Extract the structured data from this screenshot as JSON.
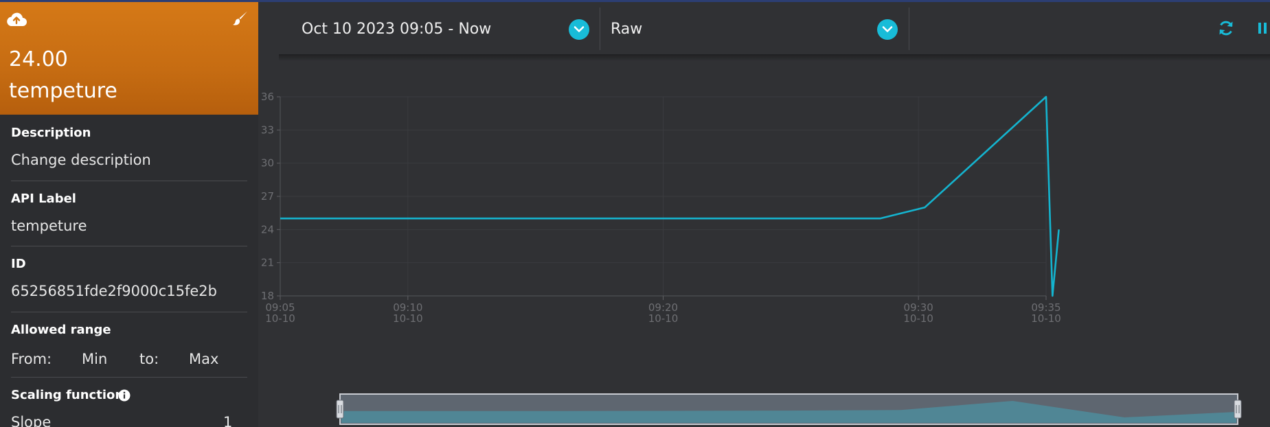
{
  "sensor": {
    "value": "24.00",
    "name": "tempeture",
    "upload_icon": "cloud-upload-icon",
    "edit_icon": "paintbrush-icon"
  },
  "details": {
    "description_label": "Description",
    "description_value": "Change description",
    "api_label_label": "API Label",
    "api_label_value": "tempeture",
    "id_label": "ID",
    "id_value": "65256851fde2f9000c15fe2b",
    "allowed_range_label": "Allowed range",
    "from_label": "From:",
    "from_value": "Min",
    "to_label": "to:",
    "to_value": "Max",
    "scaling_label": "Scaling function",
    "slope_label": "Slope",
    "slope_value": "1"
  },
  "toolbar": {
    "date_range": "Oct 10 2023 09:05 - Now",
    "resolution": "Raw",
    "refresh_icon": "refresh-icon",
    "pause_icon": "pause-icon"
  },
  "colors": {
    "accent": "#18bcd8",
    "card": "#cf7315",
    "line": "#14b4cf"
  },
  "chart_data": {
    "type": "line",
    "x_axis": "time",
    "xlim": [
      "2023-10-10 09:05",
      "2023-10-10 09:35"
    ],
    "ylim": [
      18,
      36
    ],
    "y_ticks": [
      18,
      21,
      24,
      27,
      30,
      33,
      36
    ],
    "x_ticks": [
      {
        "time": "2023-10-10 09:05",
        "line1": "09:05",
        "line2": "10-10"
      },
      {
        "time": "2023-10-10 09:10",
        "line1": "09:10",
        "line2": "10-10"
      },
      {
        "time": "2023-10-10 09:20",
        "line1": "09:20",
        "line2": "10-10"
      },
      {
        "time": "2023-10-10 09:30",
        "line1": "09:30",
        "line2": "10-10"
      },
      {
        "time": "2023-10-10 09:35",
        "line1": "09:35",
        "line2": "10-10"
      }
    ],
    "series": [
      {
        "x": [
          "2023-10-10 09:05:00",
          "2023-10-10 09:28:30",
          "2023-10-10 09:30:15",
          "2023-10-10 09:35:00",
          "2023-10-10 09:35:15",
          "2023-10-10 09:35:30"
        ],
        "y": [
          25,
          25,
          26,
          36,
          18,
          24
        ]
      }
    ],
    "navigator_y": [
      25,
      25,
      25,
      25.1,
      25.4,
      26,
      36,
      18,
      24
    ],
    "grid": true
  }
}
